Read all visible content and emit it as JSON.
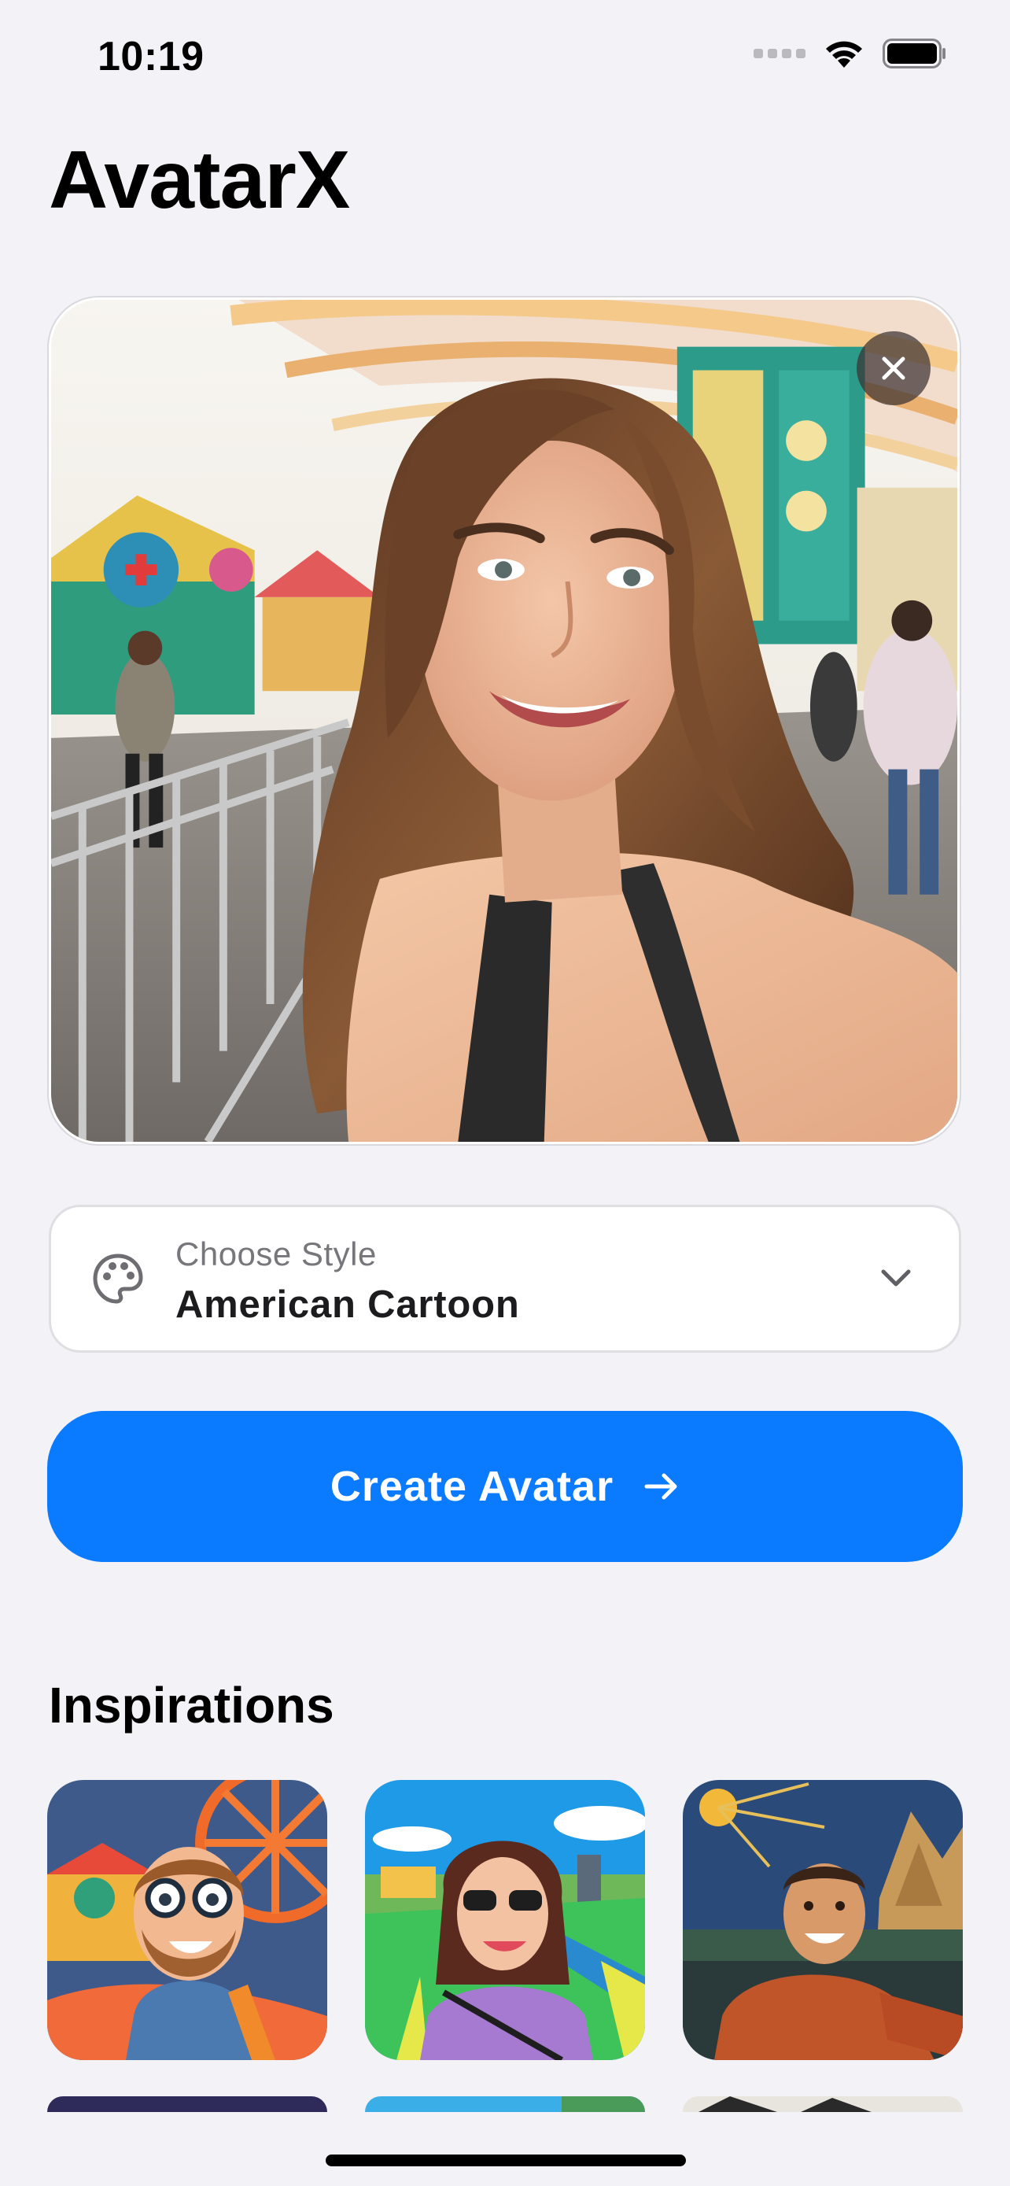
{
  "status_bar": {
    "time": "10:19"
  },
  "app": {
    "title": "AvatarX"
  },
  "photo": {
    "close_icon": "close-icon"
  },
  "style_picker": {
    "label": "Choose Style",
    "value": "American Cartoon",
    "icon": "palette-icon",
    "chevron": "chevron-down-icon"
  },
  "create_button": {
    "label": "Create Avatar",
    "icon": "arrow-right-icon",
    "color": "#0A7AFF"
  },
  "inspirations": {
    "title": "Inspirations"
  },
  "colors": {
    "background": "#F2F2F7",
    "accent": "#0A7AFF"
  }
}
